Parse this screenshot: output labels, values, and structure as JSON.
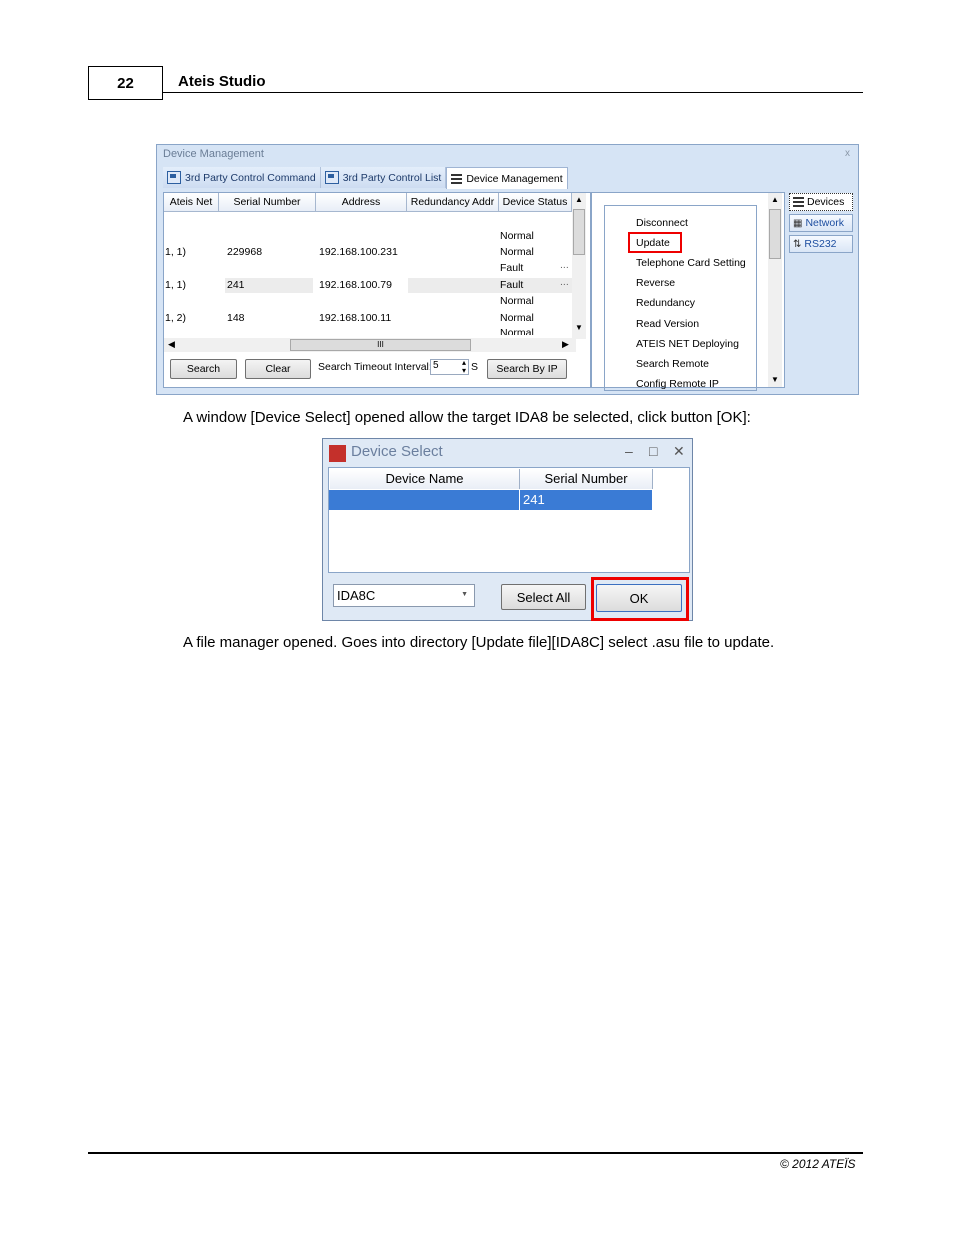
{
  "header": {
    "page_number": "22",
    "title": "Ateis Studio"
  },
  "dm": {
    "title": "Device Management",
    "close": "x",
    "tabs": [
      {
        "label": "3rd Party Control Command"
      },
      {
        "label": "3rd Party Control List"
      },
      {
        "label": "Device Management"
      }
    ],
    "columns": [
      "Ateis Net",
      "Serial Number",
      "Address",
      "Redundancy Addr",
      "Device Status"
    ],
    "rows": [
      {
        "net": "",
        "serial": "",
        "address": "",
        "redundancy": "",
        "status": "Normal"
      },
      {
        "net": "1, 1)",
        "serial": "229968",
        "address": "192.168.100.231",
        "redundancy": "",
        "status": "Normal"
      },
      {
        "net": "",
        "serial": "",
        "address": "",
        "redundancy": "",
        "status": "Fault"
      },
      {
        "net": "1, 1)",
        "serial": "241",
        "address": "192.168.100.79",
        "redundancy": "",
        "status": "Fault"
      },
      {
        "net": "",
        "serial": "",
        "address": "",
        "redundancy": "",
        "status": "Normal"
      },
      {
        "net": "1, 2)",
        "serial": "148",
        "address": "192.168.100.11",
        "redundancy": "",
        "status": "Normal"
      },
      {
        "net": "",
        "serial": "",
        "address": "",
        "redundancy": "",
        "status": "Normal"
      }
    ],
    "ellipsis": "...",
    "hscroll_mark": "III",
    "buttons": {
      "search": "Search",
      "clear": "Clear",
      "timeout_label": "Search Timeout Interval:",
      "timeout_value": "5",
      "timeout_unit": "S",
      "search_by_ip": "Search By IP"
    },
    "commands": [
      "Disconnect",
      "Update",
      "Telephone Card Setting",
      "Reverse",
      "Redundancy",
      "Read Version",
      "ATEIS NET Deploying",
      "Search Remote",
      "Config Remote IP"
    ],
    "nav": [
      "Devices",
      "Network",
      "RS232"
    ]
  },
  "para1": "A window [Device Select] opened allow the target IDA8 be selected, click button [OK]:",
  "ds": {
    "title": "Device Select",
    "minimize": "–",
    "maximize": "□",
    "close": "✕",
    "columns": [
      "Device Name",
      "Serial Number"
    ],
    "selected_row": {
      "name": "",
      "serial": "241"
    },
    "combo_value": "IDA8C",
    "combo_arrow": "▼",
    "select_all": "Select All",
    "ok": "OK"
  },
  "para2": "A file manager opened. Goes into directory [Update file][IDA8C] select .asu file to update.",
  "footer": "© 2012 ATEÏS",
  "colors": {
    "highlight": "#e00000",
    "selection": "#3a7bd5",
    "window_bg": "#d6e4f5"
  }
}
